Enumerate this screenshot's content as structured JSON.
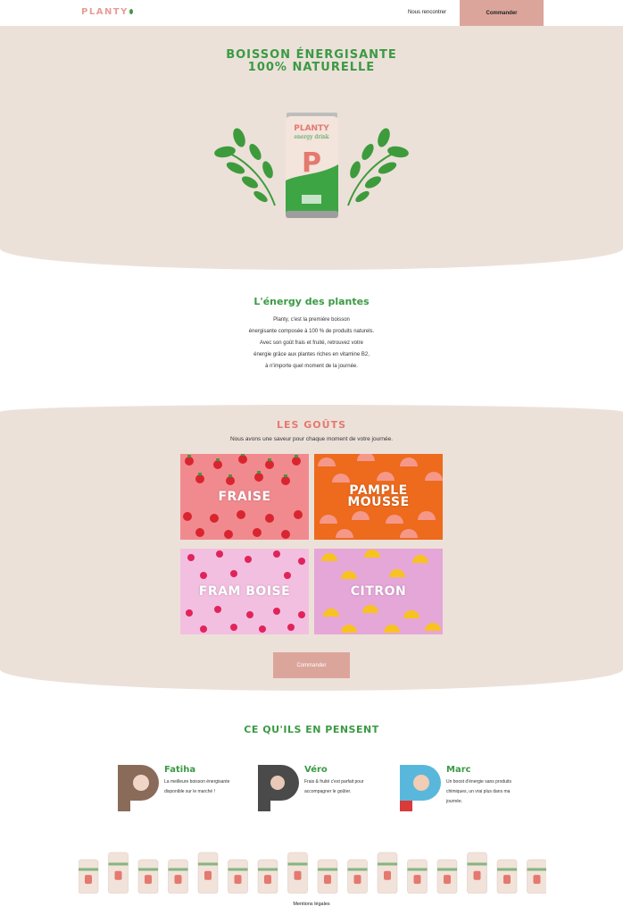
{
  "header": {
    "logo": "PLANTY",
    "nav_link": "Nous rencontrer",
    "cta": "Commander"
  },
  "hero": {
    "title_line1": "BOISSON ÉNERGISANTE",
    "title_line2": "100% NATURELLE",
    "can_brand": "PLANTY",
    "can_sub": "energy drink",
    "can_letter": "P"
  },
  "intro": {
    "title": "L'énergy des plantes",
    "lines": [
      "Planty, c'est la première boisson",
      "énergisante composée à 100 % de produits naturels.",
      "Avec son goût frais et fruité, retrouvez votre",
      "énergie grâce aux plantes riches en vitamine B2,",
      "à n'importe quel moment de la journée."
    ]
  },
  "flavours": {
    "title": "LES GOÛTS",
    "subtitle": "Nous avons une saveur pour chaque moment de votre journée.",
    "items": [
      {
        "label": "FRAISE"
      },
      {
        "label": "PAMPLE MOUSSE"
      },
      {
        "label": "FRAM BOISE"
      },
      {
        "label": "CITRON"
      }
    ],
    "cta": "Commander"
  },
  "testimonials": {
    "title": "CE QU'ILS EN PENSENT",
    "items": [
      {
        "name": "Fatiha",
        "text": "La meilleure boisson énergisante disponible sur le marché !"
      },
      {
        "name": "Véro",
        "text": "Frais & fruité c'est parfait pour accompagner le goûter."
      },
      {
        "name": "Marc",
        "text": "Un boost d'énergie sans produits chimiques, un vrai plus dans ma journée."
      }
    ]
  },
  "footer": {
    "link": "Mentions légales"
  },
  "colors": {
    "brand_pink": "#e79e96",
    "brand_green": "#3b9a44",
    "beige": "#ece1d9",
    "cta": "#dca59c"
  }
}
